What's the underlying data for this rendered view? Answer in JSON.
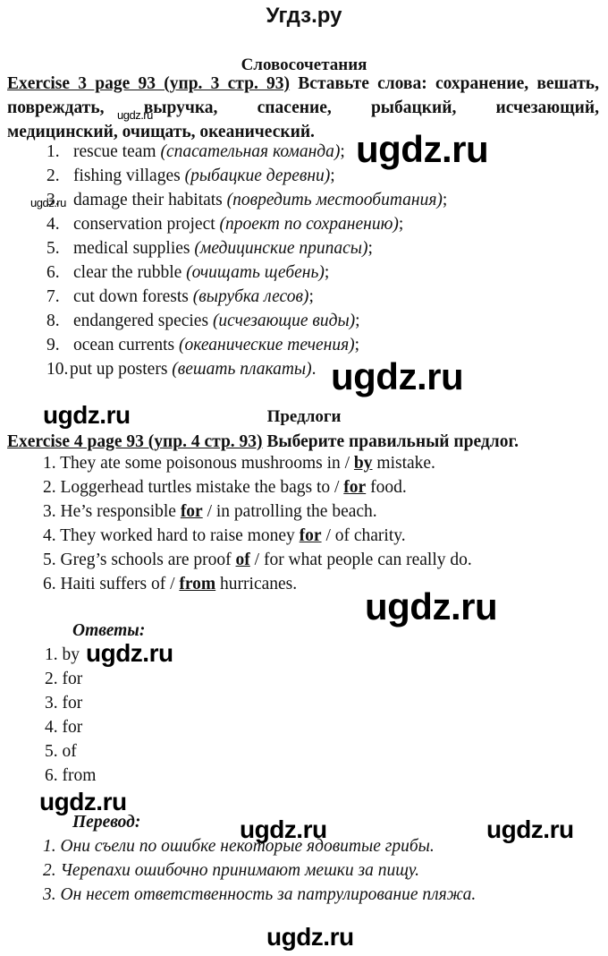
{
  "site_title": "Угдз.ру",
  "section1": {
    "title": "Словосочетания",
    "exercise_ref": "Exercise 3 page 93 (упр. 3 стр. 93)",
    "task_line1": "Вставьте слова: сохранение, вешать,",
    "task_line2": "повреждать,   выручка,   спасение,   рыбацкий,   исчезающий,",
    "task_line3": "медицинский, очищать, океанический.",
    "items": [
      {
        "num": "1.",
        "en": "rescue team",
        "ru": "(спасательная команда)",
        "end": ";"
      },
      {
        "num": "2.",
        "en": "fishing villages",
        "ru": "(рыбацкие деревни)",
        "end": ";"
      },
      {
        "num": "3.",
        "en": "damage their habitats",
        "ru": "(повредить местообитания)",
        "end": ";"
      },
      {
        "num": "4.",
        "en": "conservation project",
        "ru": "(проект по сохранению)",
        "end": ";"
      },
      {
        "num": "5.",
        "en": "medical supplies",
        "ru": "(медицинские припасы)",
        "end": ";"
      },
      {
        "num": "6.",
        "en": "clear the rubble",
        "ru": "(очищать щебень)",
        "end": ";"
      },
      {
        "num": "7.",
        "en": "cut down forests",
        "ru": "(вырубка лесов)",
        "end": ";"
      },
      {
        "num": "8.",
        "en": "endangered species",
        "ru": "(исчезающие виды)",
        "end": ";"
      },
      {
        "num": "9.",
        "en": "ocean currents",
        "ru": "(океанические течения)",
        "end": ";"
      },
      {
        "num": "10.",
        "en": "put up posters",
        "ru": "(вешать плакаты)",
        "end": "."
      }
    ]
  },
  "section2": {
    "title": "Предлоги",
    "exercise_ref": "Exercise 4 page 93 (упр. 4 стр. 93)",
    "task": "Выберите правильный предлог.",
    "items": [
      {
        "before": "1. They ate some poisonous mushrooms in / ",
        "answer": "by",
        "after": " mistake."
      },
      {
        "before": "2. Loggerhead turtles mistake the bags to / ",
        "answer": "for",
        "after": " food."
      },
      {
        "before": "3. He’s responsible ",
        "answer": "for",
        "after": " / in patrolling the beach."
      },
      {
        "before": "4. They worked hard to raise money ",
        "answer": "for",
        "after": " / of charity."
      },
      {
        "before": "5. Greg’s schools are proof ",
        "answer": "of",
        "after": " / for what people can really do."
      },
      {
        "before": "6. Haiti suffers of / ",
        "answer": "from",
        "after": " hurricanes."
      }
    ],
    "answers_title": "Ответы:",
    "answers": [
      "1. by",
      "2. for",
      "3. for",
      "4. for",
      "5. of",
      "6. from"
    ],
    "translation_title": "Перевод:",
    "translations": [
      "1. Они съели по ошибке некоторые ядовитые грибы.",
      "2. Черепахи ошибочно принимают мешки за пищу.",
      "3. Он несет ответственность за патрулирование пляжа."
    ]
  },
  "watermark": "ugdz.ru"
}
